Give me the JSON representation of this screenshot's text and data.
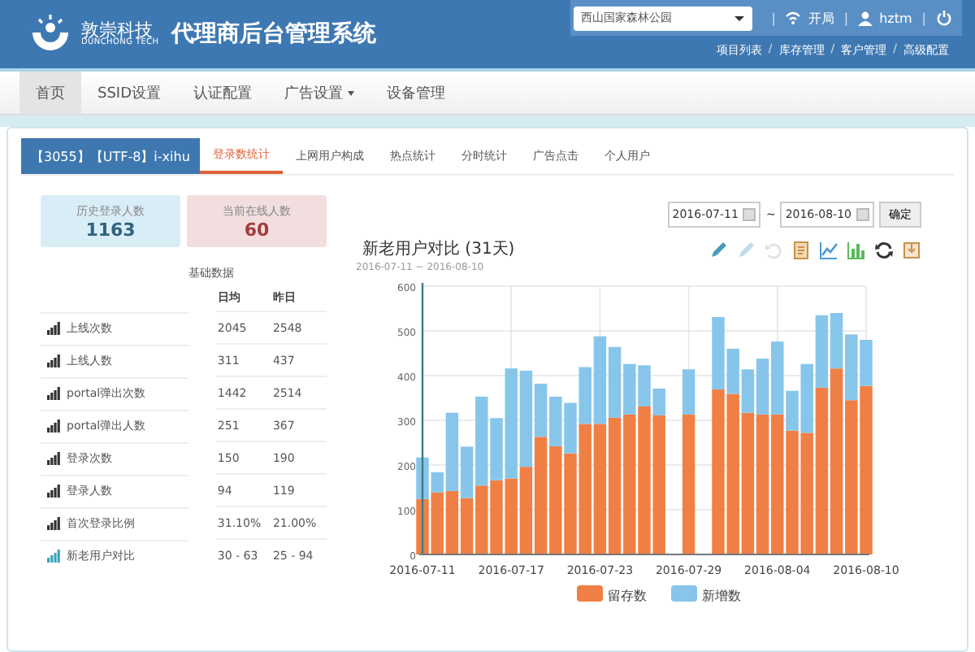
{
  "header": {
    "brand_cn": "敦崇科技",
    "brand_en": "DUNCHONG TECH",
    "title": "代理商后台管理系统",
    "site_select": {
      "value": "西山国家森林公园"
    },
    "action": "开局",
    "user": "hztm",
    "separator": "|",
    "link_separator": "/",
    "links": [
      "项目列表",
      "库存管理",
      "客户管理",
      "高级配置"
    ]
  },
  "nav": [
    {
      "label": "首页",
      "selected": true,
      "dropdown": false
    },
    {
      "label": "SSID设置",
      "selected": false,
      "dropdown": false
    },
    {
      "label": "认证配置",
      "selected": false,
      "dropdown": false
    },
    {
      "label": "广告设置",
      "selected": false,
      "dropdown": true
    },
    {
      "label": "设备管理",
      "selected": false,
      "dropdown": false
    }
  ],
  "site_label": "【3055】【UTF-8】i-xihu",
  "tabs": [
    {
      "label": "登录数统计",
      "selected": true
    },
    {
      "label": "上网用户构成",
      "selected": false
    },
    {
      "label": "热点统计",
      "selected": false
    },
    {
      "label": "分时统计",
      "selected": false
    },
    {
      "label": "广告点击",
      "selected": false
    },
    {
      "label": "个人用户",
      "selected": false
    }
  ],
  "stats": [
    {
      "label": "历史登录人数",
      "value": "1163",
      "color": "#d9edf7"
    },
    {
      "label": "当前在线人数",
      "value": "60",
      "color": "#f2dede"
    }
  ],
  "table": {
    "title": "基础数据",
    "columns": [
      "日均",
      "昨日"
    ],
    "rows": [
      {
        "name": "上线次数",
        "avg": "2045",
        "yesterday": "2548",
        "selected": false
      },
      {
        "name": "上线人数",
        "avg": "311",
        "yesterday": "437",
        "selected": false
      },
      {
        "name": "portal弹出次数",
        "avg": "1442",
        "yesterday": "2514",
        "selected": false
      },
      {
        "name": "portal弹出人数",
        "avg": "251",
        "yesterday": "367",
        "selected": false
      },
      {
        "name": "登录次数",
        "avg": "150",
        "yesterday": "190",
        "selected": false
      },
      {
        "name": "登录人数",
        "avg": "94",
        "yesterday": "119",
        "selected": false
      },
      {
        "name": "首次登录比例",
        "avg": "31.10%",
        "yesterday": "21.00%",
        "selected": false
      },
      {
        "name": "新老用户对比",
        "avg": "30 - 63",
        "yesterday": "25 - 94",
        "selected": true
      }
    ]
  },
  "date_range": {
    "from": "2016-07-11",
    "separator": "~",
    "to": "2016-08-10",
    "button": "确定"
  },
  "toolbox": [
    {
      "kind": "pencil",
      "disabled": false
    },
    {
      "kind": "pencil",
      "disabled": true
    },
    {
      "kind": "undo",
      "disabled": true
    },
    {
      "kind": "document",
      "disabled": false
    },
    {
      "kind": "line",
      "disabled": false
    },
    {
      "kind": "bar",
      "disabled": false
    },
    {
      "kind": "refresh",
      "disabled": false
    },
    {
      "kind": "save",
      "disabled": false
    }
  ],
  "chart_data": {
    "type": "bar",
    "stacked": true,
    "title": "新老用户对比 (31天)",
    "subtitle": "2016-07-11 ~ 2016-08-10",
    "categories": [
      "2016-07-11",
      null,
      null,
      null,
      null,
      null,
      "2016-07-17",
      null,
      null,
      null,
      null,
      null,
      "2016-07-23",
      null,
      null,
      null,
      null,
      null,
      "2016-07-29",
      null,
      null,
      null,
      null,
      null,
      "2016-08-04",
      null,
      null,
      null,
      null,
      null,
      "2016-08-10"
    ],
    "grid": true,
    "legend": true,
    "ylim": [
      0,
      600
    ],
    "yticks": [
      0,
      100,
      200,
      300,
      400,
      500,
      600
    ],
    "series": [
      {
        "name": "留存数",
        "color": "#f07f45",
        "values": [
          124,
          139,
          142,
          126,
          154,
          166,
          170,
          196,
          263,
          242,
          226,
          292,
          292,
          306,
          313,
          331,
          311,
          null,
          313,
          null,
          369,
          359,
          317,
          313,
          313,
          277,
          272,
          373,
          416,
          345,
          377
        ]
      },
      {
        "name": "新增数",
        "color": "#87c6ea",
        "values": [
          93,
          45,
          175,
          115,
          199,
          139,
          246,
          215,
          119,
          111,
          113,
          127,
          196,
          158,
          113,
          92,
          60,
          null,
          101,
          null,
          162,
          101,
          97,
          125,
          163,
          89,
          154,
          162,
          124,
          147,
          103
        ]
      }
    ]
  }
}
